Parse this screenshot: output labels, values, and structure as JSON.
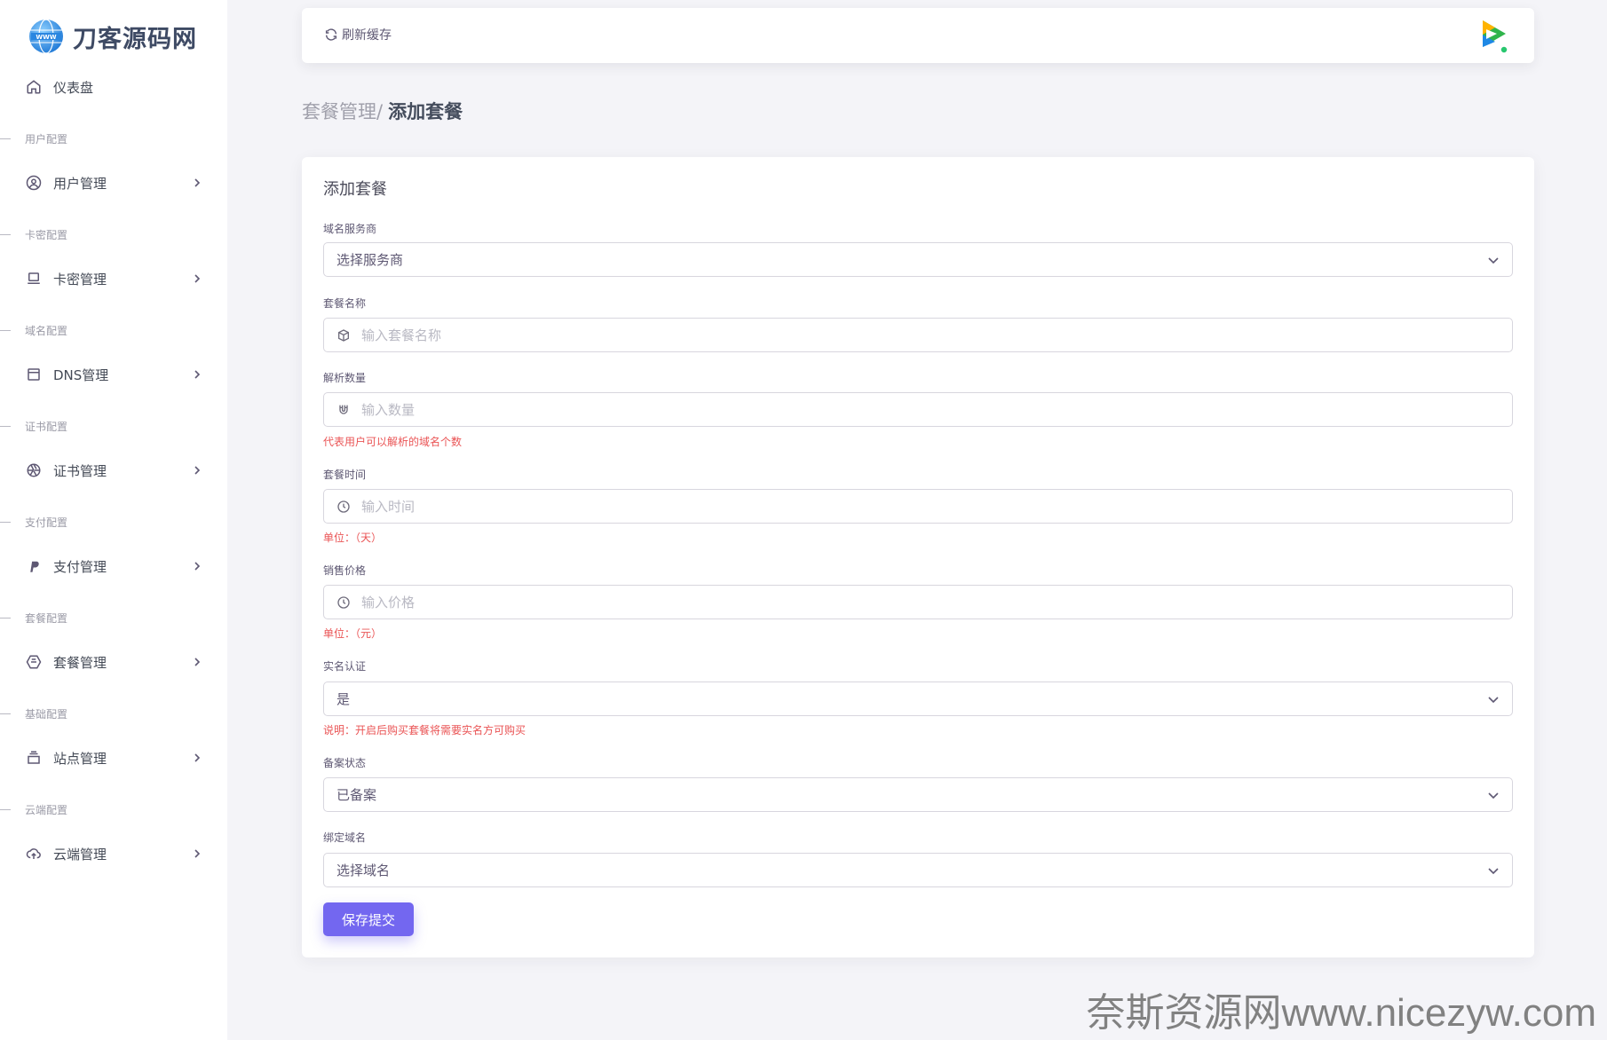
{
  "brand": {
    "name": "刀客源码网",
    "logo_icon": "globe-www-icon"
  },
  "sidebar": {
    "dashboard": {
      "label": "仪表盘",
      "icon": "home-icon"
    },
    "sections": [
      {
        "title": "用户配置",
        "item": {
          "label": "用户管理",
          "icon": "user-circle-icon"
        }
      },
      {
        "title": "卡密配置",
        "item": {
          "label": "卡密管理",
          "icon": "laptop-icon"
        }
      },
      {
        "title": "域名配置",
        "item": {
          "label": "DNS管理",
          "icon": "calendar-box-icon"
        }
      },
      {
        "title": "证书配置",
        "item": {
          "label": "证书管理",
          "icon": "aperture-icon"
        }
      },
      {
        "title": "支付配置",
        "item": {
          "label": "支付管理",
          "icon": "paypal-icon"
        }
      },
      {
        "title": "套餐配置",
        "item": {
          "label": "套餐管理",
          "icon": "package-hex-icon"
        }
      },
      {
        "title": "基础配置",
        "item": {
          "label": "站点管理",
          "icon": "archive-icon"
        }
      },
      {
        "title": "云端配置",
        "item": {
          "label": "云端管理",
          "icon": "cloud-upload-icon"
        }
      }
    ]
  },
  "topbar": {
    "refresh_label": "刷新缓存",
    "avatar_icon": "video-app-icon"
  },
  "breadcrumb": {
    "parent": "套餐管理",
    "separator": "/",
    "current": "添加套餐"
  },
  "form": {
    "title": "添加套餐",
    "provider": {
      "label": "域名服务商",
      "value": "选择服务商"
    },
    "name": {
      "label": "套餐名称",
      "placeholder": "输入套餐名称",
      "icon": "box-icon"
    },
    "count": {
      "label": "解析数量",
      "placeholder": "输入数量",
      "icon": "magnet-icon",
      "hint": "代表用户可以解析的域名个数"
    },
    "duration": {
      "label": "套餐时间",
      "placeholder": "输入时间",
      "icon": "clock-icon",
      "hint": "单位：（天）"
    },
    "price": {
      "label": "销售价格",
      "placeholder": "输入价格",
      "icon": "clock-icon",
      "hint": "单位：（元）"
    },
    "realname": {
      "label": "实名认证",
      "value": "是",
      "hint": "说明：开启后购买套餐将需要实名方可购买"
    },
    "icp": {
      "label": "备案状态",
      "value": "已备案"
    },
    "domain": {
      "label": "绑定域名",
      "value": "选择域名"
    },
    "submit_label": "保存提交"
  },
  "watermark": "奈斯资源网www.nicezyw.com",
  "colors": {
    "primary": "#7367f0",
    "danger": "#ea5455",
    "background": "#f4f4f8"
  }
}
